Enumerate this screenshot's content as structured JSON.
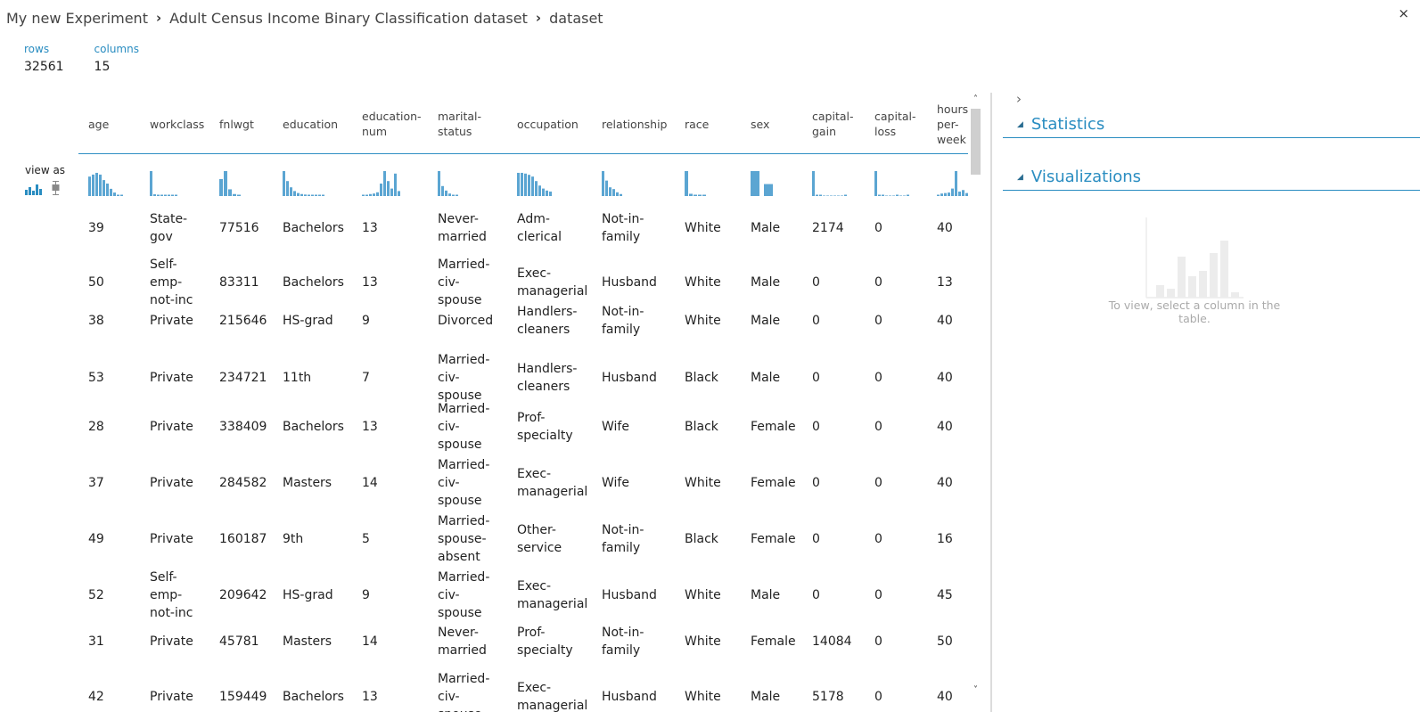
{
  "breadcrumb": {
    "items": [
      "My new Experiment",
      "Adult Census Income Binary Classification dataset",
      "dataset"
    ],
    "separator": "›"
  },
  "close_glyph": "×",
  "summary": {
    "rows_label": "rows",
    "rows_value": "32561",
    "columns_label": "columns",
    "columns_value": "15"
  },
  "view_as": {
    "label": "view as",
    "modes": [
      "histogram-icon",
      "boxplot-icon"
    ]
  },
  "table": {
    "columns": [
      "age",
      "workclass",
      "fnlwgt",
      "education",
      "education-num",
      "marital-status",
      "occupation",
      "relationship",
      "race",
      "sex",
      "capital-gain",
      "capital-loss",
      "hours-per-week"
    ],
    "column_headers_wrapped": [
      [
        "age"
      ],
      [
        "workclass"
      ],
      [
        "fnlwgt"
      ],
      [
        "education"
      ],
      [
        "education-",
        "num"
      ],
      [
        "marital-",
        "status"
      ],
      [
        "occupation"
      ],
      [
        "relationship"
      ],
      [
        "race"
      ],
      [
        "sex"
      ],
      [
        "capital-",
        "gain"
      ],
      [
        "capital-",
        "loss"
      ],
      [
        "hours-",
        "per-",
        "week"
      ]
    ],
    "rows": [
      [
        "39",
        "State-gov",
        "77516",
        "Bachelors",
        "13",
        "Never-married",
        "Adm-clerical",
        "Not-in-family",
        "White",
        "Male",
        "2174",
        "0",
        "40"
      ],
      [
        "50",
        "Self-emp-not-inc",
        "83311",
        "Bachelors",
        "13",
        "Married-civ-spouse",
        "Exec-managerial",
        "Husband",
        "White",
        "Male",
        "0",
        "0",
        "13"
      ],
      [
        "38",
        "Private",
        "215646",
        "HS-grad",
        "9",
        "Divorced",
        "Handlers-cleaners",
        "Not-in-family",
        "White",
        "Male",
        "0",
        "0",
        "40"
      ],
      [
        "53",
        "Private",
        "234721",
        "11th",
        "7",
        "Married-civ-spouse",
        "Handlers-cleaners",
        "Husband",
        "Black",
        "Male",
        "0",
        "0",
        "40"
      ],
      [
        "28",
        "Private",
        "338409",
        "Bachelors",
        "13",
        "Married-civ-spouse",
        "Prof-specialty",
        "Wife",
        "Black",
        "Female",
        "0",
        "0",
        "40"
      ],
      [
        "37",
        "Private",
        "284582",
        "Masters",
        "14",
        "Married-civ-spouse",
        "Exec-managerial",
        "Wife",
        "White",
        "Female",
        "0",
        "0",
        "40"
      ],
      [
        "49",
        "Private",
        "160187",
        "9th",
        "5",
        "Married-spouse-absent",
        "Other-service",
        "Not-in-family",
        "Black",
        "Female",
        "0",
        "0",
        "16"
      ],
      [
        "52",
        "Self-emp-not-inc",
        "209642",
        "HS-grad",
        "9",
        "Married-civ-spouse",
        "Exec-managerial",
        "Husband",
        "White",
        "Male",
        "0",
        "0",
        "45"
      ],
      [
        "31",
        "Private",
        "45781",
        "Masters",
        "14",
        "Never-married",
        "Prof-specialty",
        "Not-in-family",
        "White",
        "Female",
        "14084",
        "0",
        "50"
      ],
      [
        "42",
        "Private",
        "159449",
        "Bachelors",
        "13",
        "Married-civ-spouse",
        "Exec-managerial",
        "Husband",
        "White",
        "Male",
        "5178",
        "0",
        "40"
      ]
    ],
    "rows_wrapped": [
      [
        [
          "39"
        ],
        [
          "State-",
          "gov"
        ],
        [
          "77516"
        ],
        [
          "Bachelors"
        ],
        [
          "13"
        ],
        [
          "Never-",
          "married"
        ],
        [
          "Adm-",
          "clerical"
        ],
        [
          "Not-in-",
          "family"
        ],
        [
          "White"
        ],
        [
          "Male"
        ],
        [
          "2174"
        ],
        [
          "0"
        ],
        [
          "40"
        ]
      ],
      [
        [
          "50"
        ],
        [
          "Self-",
          "emp-",
          "not-inc"
        ],
        [
          "83311"
        ],
        [
          "Bachelors"
        ],
        [
          "13"
        ],
        [
          "Married-",
          "civ-",
          "spouse"
        ],
        [
          "Exec-",
          "managerial"
        ],
        [
          "Husband"
        ],
        [
          "White"
        ],
        [
          "Male"
        ],
        [
          "0"
        ],
        [
          "0"
        ],
        [
          "13"
        ]
      ],
      [
        [
          "38"
        ],
        [
          "Private"
        ],
        [
          "215646"
        ],
        [
          "HS-grad"
        ],
        [
          "9"
        ],
        [
          "Divorced"
        ],
        [
          "Handlers-",
          "cleaners"
        ],
        [
          "Not-in-",
          "family"
        ],
        [
          "White"
        ],
        [
          "Male"
        ],
        [
          "0"
        ],
        [
          "0"
        ],
        [
          "40"
        ]
      ],
      [
        [
          "53"
        ],
        [
          "Private"
        ],
        [
          "234721"
        ],
        [
          "11th"
        ],
        [
          "7"
        ],
        [
          "Married-",
          "civ-",
          "spouse"
        ],
        [
          "Handlers-",
          "cleaners"
        ],
        [
          "Husband"
        ],
        [
          "Black"
        ],
        [
          "Male"
        ],
        [
          "0"
        ],
        [
          "0"
        ],
        [
          "40"
        ]
      ],
      [
        [
          "28"
        ],
        [
          "Private"
        ],
        [
          "338409"
        ],
        [
          "Bachelors"
        ],
        [
          "13"
        ],
        [
          "Married-",
          "civ-",
          "spouse"
        ],
        [
          "Prof-",
          "specialty"
        ],
        [
          "Wife"
        ],
        [
          "Black"
        ],
        [
          "Female"
        ],
        [
          "0"
        ],
        [
          "0"
        ],
        [
          "40"
        ]
      ],
      [
        [
          "37"
        ],
        [
          "Private"
        ],
        [
          "284582"
        ],
        [
          "Masters"
        ],
        [
          "14"
        ],
        [
          "Married-",
          "civ-",
          "spouse"
        ],
        [
          "Exec-",
          "managerial"
        ],
        [
          "Wife"
        ],
        [
          "White"
        ],
        [
          "Female"
        ],
        [
          "0"
        ],
        [
          "0"
        ],
        [
          "40"
        ]
      ],
      [
        [
          "49"
        ],
        [
          "Private"
        ],
        [
          "160187"
        ],
        [
          "9th"
        ],
        [
          "5"
        ],
        [
          "Married-",
          "spouse-",
          "absent"
        ],
        [
          "Other-",
          "service"
        ],
        [
          "Not-in-",
          "family"
        ],
        [
          "Black"
        ],
        [
          "Female"
        ],
        [
          "0"
        ],
        [
          "0"
        ],
        [
          "16"
        ]
      ],
      [
        [
          "52"
        ],
        [
          "Self-",
          "emp-",
          "not-inc"
        ],
        [
          "209642"
        ],
        [
          "HS-grad"
        ],
        [
          "9"
        ],
        [
          "Married-",
          "civ-",
          "spouse"
        ],
        [
          "Exec-",
          "managerial"
        ],
        [
          "Husband"
        ],
        [
          "White"
        ],
        [
          "Male"
        ],
        [
          "0"
        ],
        [
          "0"
        ],
        [
          "45"
        ]
      ],
      [
        [
          "31"
        ],
        [
          "Private"
        ],
        [
          "45781"
        ],
        [
          "Masters"
        ],
        [
          "14"
        ],
        [
          "Never-",
          "married"
        ],
        [
          "Prof-",
          "specialty"
        ],
        [
          "Not-in-",
          "family"
        ],
        [
          "White"
        ],
        [
          "Female"
        ],
        [
          "14084"
        ],
        [
          "0"
        ],
        [
          "50"
        ]
      ],
      [
        [
          "42"
        ],
        [
          "Private"
        ],
        [
          "159449"
        ],
        [
          "Bachelors"
        ],
        [
          "13"
        ],
        [
          "Married-",
          "civ-",
          "spouse"
        ],
        [
          "Exec-",
          "managerial"
        ],
        [
          "Husband"
        ],
        [
          "White"
        ],
        [
          "Male"
        ],
        [
          "5178"
        ],
        [
          "0"
        ],
        [
          "40"
        ]
      ]
    ],
    "column_histograms": [
      [
        0.78,
        0.86,
        0.93,
        0.86,
        0.64,
        0.5,
        0.29,
        0.14,
        0.05,
        0.02
      ],
      [
        1.0,
        0.07,
        0.05,
        0.04,
        0.04,
        0.03,
        0.02,
        0.02
      ],
      [
        0.68,
        1.0,
        0.27,
        0.08,
        0.02
      ],
      [
        1.0,
        0.6,
        0.35,
        0.2,
        0.12,
        0.08,
        0.06,
        0.05,
        0.04,
        0.03,
        0.03,
        0.02
      ],
      [
        0.03,
        0.05,
        0.08,
        0.1,
        0.15,
        0.5,
        1.0,
        0.6,
        0.3,
        0.9,
        0.2
      ],
      [
        1.0,
        0.4,
        0.22,
        0.1,
        0.04,
        0.03
      ],
      [
        0.93,
        0.93,
        0.9,
        0.85,
        0.78,
        0.6,
        0.42,
        0.3,
        0.22,
        0.18
      ],
      [
        1.0,
        0.62,
        0.35,
        0.28,
        0.15,
        0.08
      ],
      [
        1.0,
        0.09,
        0.04,
        0.02,
        0.01
      ],
      [
        1.0,
        0.48
      ],
      [
        1.0,
        0.02,
        0.01,
        0.0,
        0.0,
        0.0,
        0.0,
        0.0,
        0.0,
        0.01
      ],
      [
        1.0,
        0.02,
        0.01,
        0.0,
        0.0,
        0.0,
        0.02,
        0.0,
        0.0,
        0.01
      ],
      [
        0.04,
        0.1,
        0.12,
        0.14,
        0.3,
        1.0,
        0.18,
        0.24,
        0.12,
        0.06
      ]
    ]
  },
  "scroll": {
    "up_glyph": "˄",
    "down_glyph": "˅"
  },
  "right_panel": {
    "expand_glyph": "›",
    "sections": [
      {
        "title": "Statistics",
        "expanded": true
      },
      {
        "title": "Visualizations",
        "expanded": true
      }
    ],
    "collapse_glyph": "◢",
    "empty_message": "To view, select a column in the table."
  },
  "colors": {
    "accent": "#2a8dc1",
    "histogram_bar": "#5ba5d2",
    "viz_placeholder": "#ececec"
  }
}
